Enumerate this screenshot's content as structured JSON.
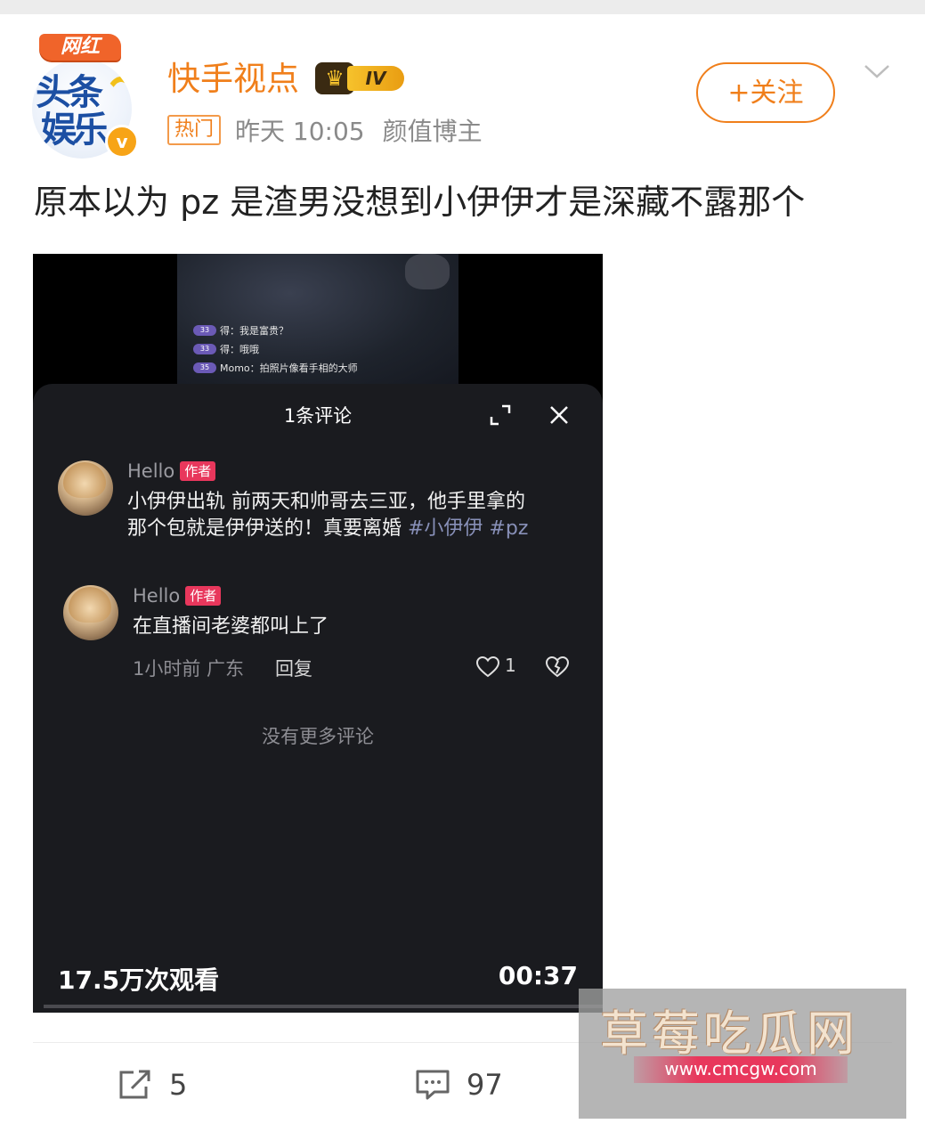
{
  "post": {
    "avatar_top_badge": "网红",
    "avatar_line1": "头条",
    "avatar_line2": "娱乐",
    "verified_mark": "v",
    "username": "快手视点",
    "rank_label": "IV",
    "hot_tag": "热门",
    "time": "昨天 10:05",
    "role": "颜值博主",
    "follow_label": "+关注",
    "text": "原本以为 pz 是渣男没想到小伊伊才是深藏不露那个"
  },
  "video": {
    "live_comments": [
      {
        "level": "33",
        "text": "得：我是富贵？"
      },
      {
        "level": "33",
        "text": "得：哦哦"
      },
      {
        "level": "35",
        "text": "Momo：拍照片像看手相的大师"
      }
    ],
    "panel_title": "1条评论",
    "comments": [
      {
        "name": "Hello",
        "author_tag": "作者",
        "line1": "小伊伊出轨 前两天和帅哥去三亚，他手里拿的",
        "line2_prefix": "那个包就是伊伊送的！真要离婚 ",
        "tags": "#小伊伊 #pz"
      },
      {
        "name": "Hello",
        "author_tag": "作者",
        "text": "在直播间老婆都叫上了",
        "meta": "1小时前 广东",
        "reply_label": "回复",
        "like_count": "1"
      }
    ],
    "no_more": "没有更多评论",
    "views": "17.5万次观看",
    "duration": "00:37"
  },
  "actions": {
    "share_count": "5",
    "comment_count": "97"
  },
  "watermark": {
    "title": "草莓吃瓜网",
    "url": "www.cmcgw.com"
  },
  "colors": {
    "brand_orange": "#f07f1b",
    "author_tag": "#e8375c",
    "panel_bg": "#1a1b1f"
  }
}
